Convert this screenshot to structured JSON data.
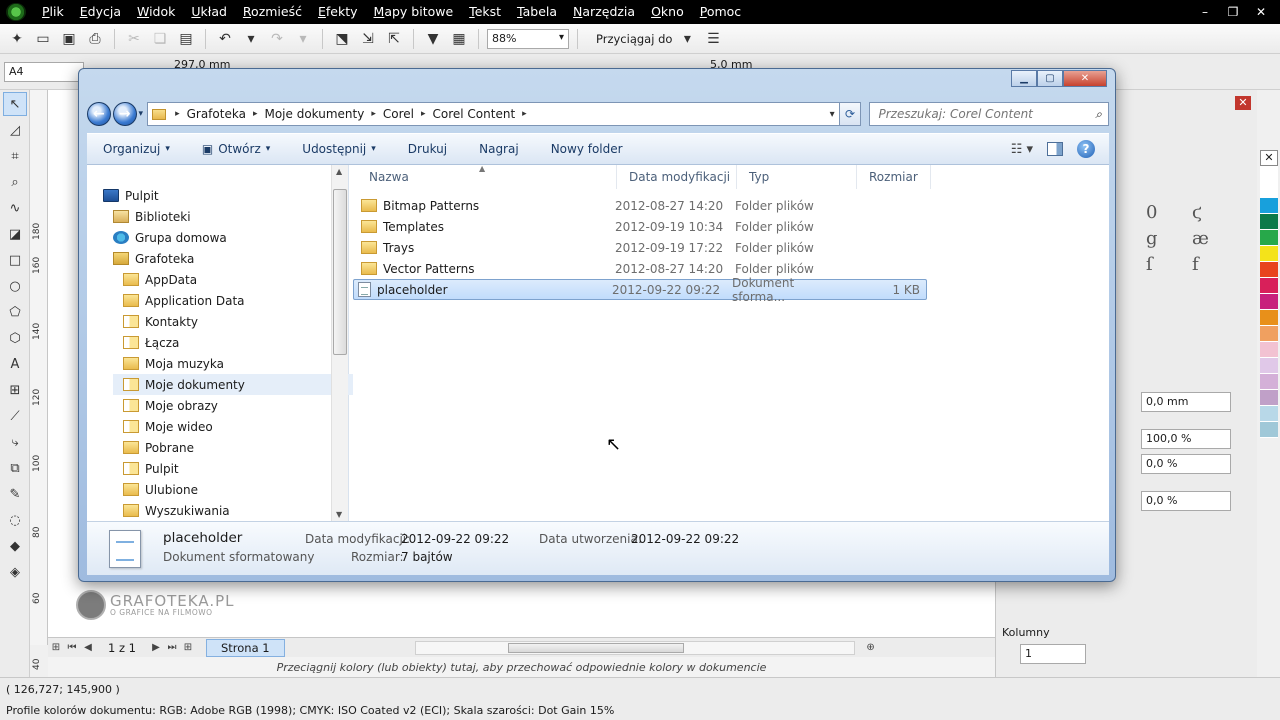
{
  "menubar": {
    "items": [
      "Plik",
      "Edycja",
      "Widok",
      "Układ",
      "Rozmieść",
      "Efekty",
      "Mapy bitowe",
      "Tekst",
      "Tabela",
      "Narzędzia",
      "Okno",
      "Pomoc"
    ]
  },
  "toolbar": {
    "zoom": "88%",
    "snap_label": "Przyciągaj do"
  },
  "propbar": {
    "page_size": "A4",
    "width": "297,0 mm",
    "nudge": "5,0 mm"
  },
  "ruler": {
    "ticks": [
      "180",
      "160",
      "140",
      "120",
      "100",
      "80",
      "60",
      "40"
    ],
    "unit": "milimetry"
  },
  "watermark": {
    "title": "GRAFOTEKA.PL",
    "subtitle": "O GRAFICE NA FILMOWO"
  },
  "pagenav": {
    "count": "1 z 1",
    "page_tab": "Strona 1"
  },
  "palette_hint": "Przeciągnij kolory (lub obiekty) tutaj, aby przechować odpowiednie kolory w dokumencie",
  "status": {
    "coords": "( 126,727; 145,900 )",
    "profiles": "Profile kolorów dokumentu: RGB: Adobe RGB (1998); CMYK: ISO Coated v2 (ECI); Skala szarości: Dot Gain 15%"
  },
  "docker": {
    "fields": [
      "0,0 mm",
      "100,0 %",
      "0,0 %",
      "0,0 %"
    ],
    "columns_label": "Kolumny",
    "columns_value": "1"
  },
  "colors": {
    "palette": [
      "#ffffff",
      "#ffffff",
      "#18a0dc",
      "#0c7a4a",
      "#27a84a",
      "#f4e31a",
      "#e8441e",
      "#d8205a",
      "#c8207c",
      "#e8901a",
      "#f0a060",
      "#f2c2d2",
      "#e0c8e8",
      "#d4b0d8",
      "#c0a0c8",
      "#b8d8e8",
      "#a0c8d8"
    ]
  },
  "dialog": {
    "breadcrumb": [
      "Grafoteka",
      "Moje dokumenty",
      "Corel",
      "Corel Content"
    ],
    "search_placeholder": "Przeszukaj: Corel Content",
    "commands": {
      "organize": "Organizuj",
      "open": "Otwórz",
      "share": "Udostępnij",
      "print": "Drukuj",
      "burn": "Nagraj",
      "new_folder": "Nowy folder"
    },
    "tree": [
      {
        "label": "Pulpit",
        "icon": "desktop-icon"
      },
      {
        "label": "Biblioteki",
        "icon": "libraries-icon"
      },
      {
        "label": "Grupa domowa",
        "icon": "homegroup-icon"
      },
      {
        "label": "Grafoteka",
        "icon": "user-folder-icon"
      },
      {
        "label": "AppData",
        "icon": "folder-icon"
      },
      {
        "label": "Application Data",
        "icon": "folder-icon"
      },
      {
        "label": "Kontakty",
        "icon": "contacts-icon"
      },
      {
        "label": "Łącza",
        "icon": "links-icon"
      },
      {
        "label": "Moja muzyka",
        "icon": "music-folder-icon"
      },
      {
        "label": "Moje dokumenty",
        "icon": "documents-folder-icon"
      },
      {
        "label": "Moje obrazy",
        "icon": "pictures-folder-icon"
      },
      {
        "label": "Moje wideo",
        "icon": "videos-folder-icon"
      },
      {
        "label": "Pobrane",
        "icon": "downloads-folder-icon"
      },
      {
        "label": "Pulpit",
        "icon": "desktop-folder-icon"
      },
      {
        "label": "Ulubione",
        "icon": "favorites-folder-icon"
      },
      {
        "label": "Wyszukiwania",
        "icon": "searches-folder-icon"
      }
    ],
    "columns": [
      "Nazwa",
      "Data modyfikacji",
      "Typ",
      "Rozmiar"
    ],
    "files": [
      {
        "name": "Bitmap Patterns",
        "date": "2012-08-27 14:20",
        "type": "Folder plików",
        "size": ""
      },
      {
        "name": "Templates",
        "date": "2012-09-19 10:34",
        "type": "Folder plików",
        "size": ""
      },
      {
        "name": "Trays",
        "date": "2012-09-19 17:22",
        "type": "Folder plików",
        "size": ""
      },
      {
        "name": "Vector Patterns",
        "date": "2012-08-27 14:20",
        "type": "Folder plików",
        "size": ""
      },
      {
        "name": "placeholder",
        "date": "2012-09-22 09:22",
        "type": "Dokument sforma...",
        "size": "1 KB"
      }
    ],
    "details": {
      "name": "placeholder",
      "type": "Dokument sformatowany",
      "modified_label": "Data modyfikacji:",
      "modified_value": "2012-09-22 09:22",
      "created_label": "Data utworzenia:",
      "created_value": "2012-09-22 09:22",
      "size_label": "Rozmiar:",
      "size_value": "7 bajtów"
    }
  }
}
